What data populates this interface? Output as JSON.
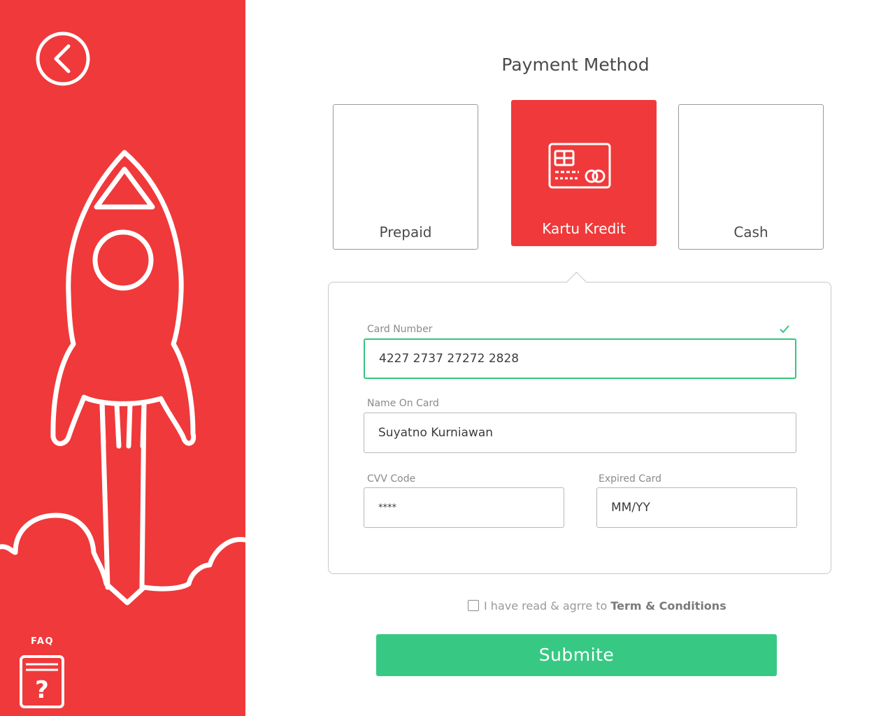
{
  "colors": {
    "sidebar": "#f0393a",
    "accent_green": "#37c984",
    "valid_border": "#37c57f",
    "text_dark": "#4a4a4a",
    "text_muted": "#8a8a8a"
  },
  "sidebar": {
    "back_icon": "chevron-left-circle-icon",
    "illustration": "rocket-launch-illustration",
    "faq_label": "FAQ",
    "faq_icon": "faq-document-question-icon"
  },
  "page": {
    "title": "Payment Method"
  },
  "payment_methods": [
    {
      "label": "Prepaid",
      "selected": false
    },
    {
      "label": "Kartu Kredit",
      "selected": true,
      "icon": "credit-card-icon"
    },
    {
      "label": "Cash",
      "selected": false
    }
  ],
  "form": {
    "card_number": {
      "label": "Card Number",
      "value": "4227 2737 27272 2828",
      "valid": true
    },
    "name_on_card": {
      "label": "Name On Card",
      "value": "Suyatno Kurniawan"
    },
    "cvv": {
      "label": "CVV Code",
      "value": "****"
    },
    "expiry": {
      "label": "Expired Card",
      "placeholder": "MM/YY"
    }
  },
  "agreement": {
    "text": "I have read & agrre to",
    "link": "Term & Conditions",
    "checked": false
  },
  "submit_label": "Submite"
}
